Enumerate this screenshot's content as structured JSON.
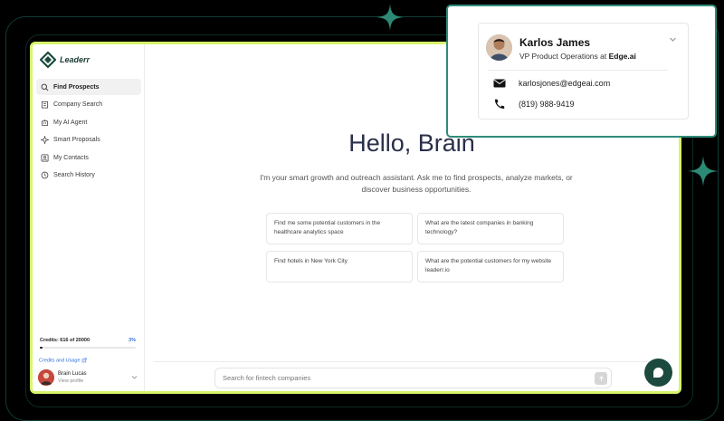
{
  "colors": {
    "accent_border": "#d6f56a",
    "brand_dark": "#1c4a3f",
    "card_border": "#2f8b79",
    "link_blue": "#2f6fde"
  },
  "brand": {
    "name": "Leaderr"
  },
  "sidebar": {
    "items": [
      {
        "label": "Find Prospects",
        "icon": "search-icon",
        "active": true
      },
      {
        "label": "Company Search",
        "icon": "building-icon",
        "active": false
      },
      {
        "label": "My AI Agent",
        "icon": "robot-icon",
        "active": false
      },
      {
        "label": "Smart Proposals",
        "icon": "sparkle-icon",
        "active": false
      },
      {
        "label": "My Contacts",
        "icon": "contact-icon",
        "active": false
      },
      {
        "label": "Search History",
        "icon": "history-icon",
        "active": false
      }
    ],
    "credits": {
      "label": "Credits: 616 of 20000",
      "percent_label": "3%",
      "fraction": 0.03
    },
    "credits_link": "Credits and Usage",
    "profile": {
      "name": "Brain Lucas",
      "sub": "View profile"
    }
  },
  "main": {
    "greeting": "Hello, Brain",
    "subtitle": "I'm your smart growth and outreach assistant. Ask me to find prospects, analyze markets, or discover business opportunities.",
    "suggestions": [
      "Find me some potential customers in the healthcare analytics space",
      "What are the latest companies in banking technology?",
      "Find hotels in New York City",
      "What are the potential customers for my website leaderr.io"
    ],
    "search": {
      "placeholder": "Search for fintech companies",
      "value": ""
    }
  },
  "contact_card": {
    "name": "Karlos James",
    "title_prefix": "VP Product Operations at",
    "company": "Edge.ai",
    "email": "karlosjones@edgeai.com",
    "phone": "(819) 988-9419"
  }
}
